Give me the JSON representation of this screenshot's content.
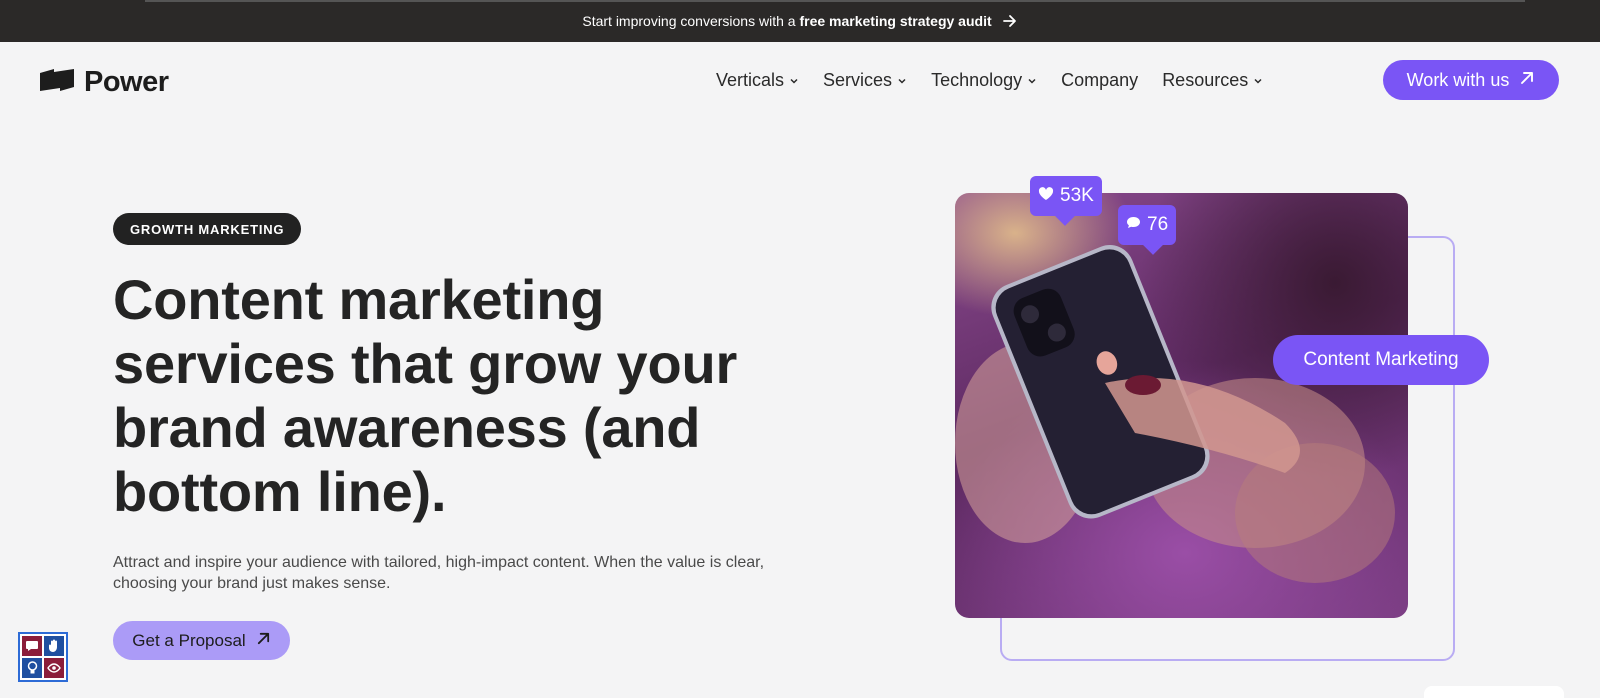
{
  "announcement": {
    "text_prefix": "Start improving conversions with a",
    "text_bold": "free marketing strategy audit",
    "icon": "arrow-right-icon"
  },
  "header": {
    "logo_text": "Power",
    "nav": [
      {
        "label": "Verticals",
        "has_dropdown": true
      },
      {
        "label": "Services",
        "has_dropdown": true
      },
      {
        "label": "Technology",
        "has_dropdown": true
      },
      {
        "label": "Company",
        "has_dropdown": false
      },
      {
        "label": "Resources",
        "has_dropdown": true
      }
    ],
    "cta_label": "Work with us"
  },
  "hero": {
    "badge": "GROWTH MARKETING",
    "title": "Content marketing services that grow your brand awareness (and bottom line).",
    "description": "Attract and inspire your audience with tailored, high-impact content. When the value is clear, choosing your brand just makes sense.",
    "cta_label": "Get a Proposal"
  },
  "visual": {
    "likes": "53K",
    "comments": "76",
    "topic": "Content Marketing"
  },
  "colors": {
    "accent": "#7a55f5",
    "accent_light": "#ab9bf7",
    "outline": "#b9acf3",
    "topbar": "#2b2928",
    "background": "#f4f4f5"
  }
}
